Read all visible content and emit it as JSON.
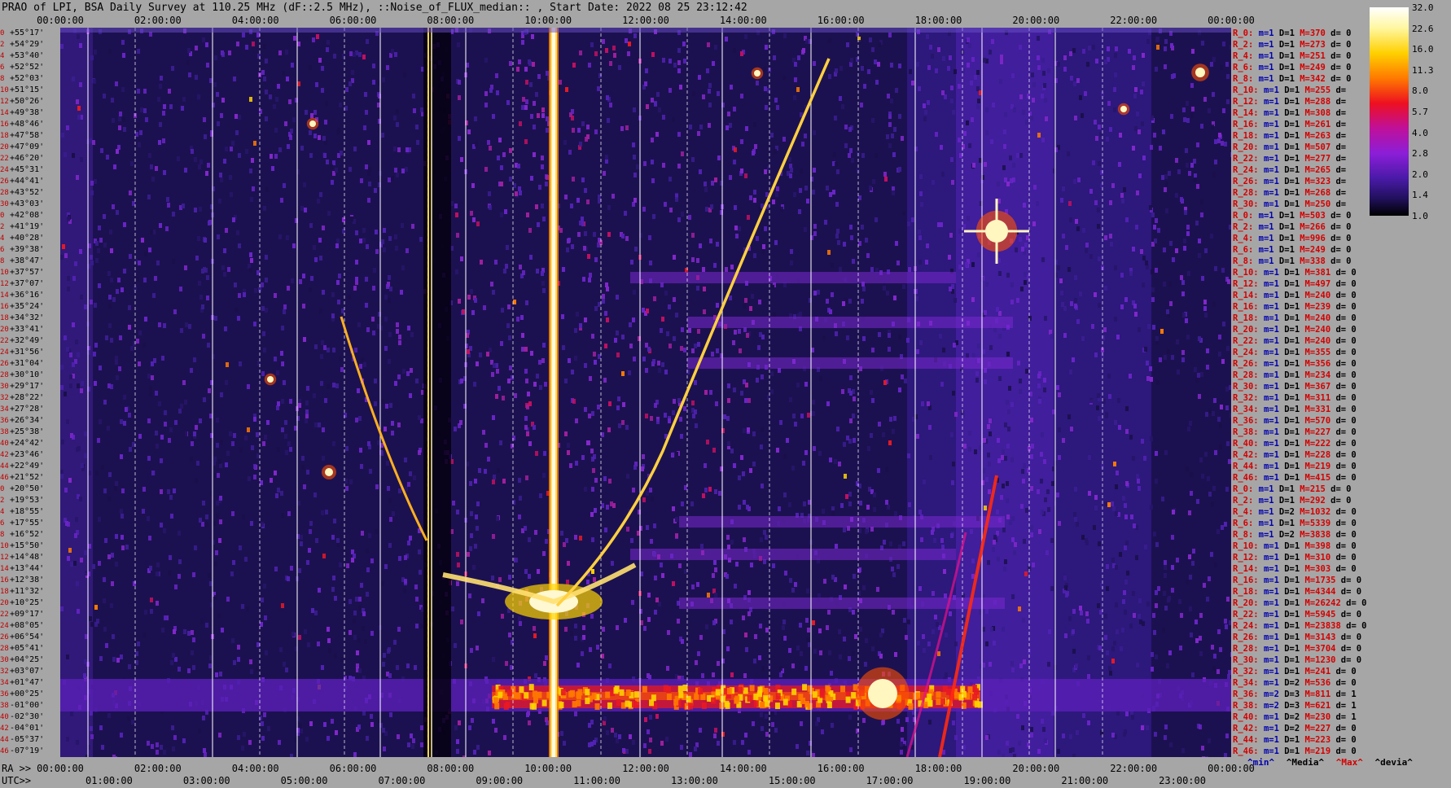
{
  "title": "PRAO of LPI, BSA Daily Survey at 110.25 MHz (dF::2.5 MHz), ::Noise_of_FLUX_median:: , Start Date: 2022 08 25 23:12:42",
  "top_ticks": [
    "00:00:00",
    "02:00:00",
    "04:00:00",
    "06:00:00",
    "08:00:00",
    "10:00:00",
    "12:00:00",
    "14:00:00",
    "16:00:00",
    "18:00:00",
    "20:00:00",
    "22:00:00",
    "00:00:00"
  ],
  "ra_label": "RA >>",
  "ra_ticks": [
    "00:00:00",
    "02:00:00",
    "04:00:00",
    "06:00:00",
    "08:00:00",
    "10:00:00",
    "12:00:00",
    "14:00:00",
    "16:00:00",
    "18:00:00",
    "20:00:00",
    "22:00:00",
    "00:00:00"
  ],
  "utc_label": "UTC>>",
  "utc_ticks": [
    "01:00:00",
    "03:00:00",
    "05:00:00",
    "07:00:00",
    "09:00:00",
    "11:00:00",
    "13:00:00",
    "15:00:00",
    "17:00:00",
    "19:00:00",
    "21:00:00",
    "23:00:00"
  ],
  "declinations": [
    "+55°17'",
    "+54°29'",
    "+53°40'",
    "+52°52'",
    "+52°03'",
    "+51°15'",
    "+50°26'",
    "+49°38'",
    "+48°46'",
    "+47°58'",
    "+47°09'",
    "+46°20'",
    "+45°31'",
    "+44°41'",
    "+43°52'",
    "+43°03'",
    "+42°08'",
    "+41°19'",
    "+40°28'",
    "+39°38'",
    "+38°47'",
    "+37°57'",
    "+37°07'",
    "+36°16'",
    "+35°24'",
    "+34°32'",
    "+33°41'",
    "+32°49'",
    "+31°56'",
    "+31°04'",
    "+30°10'",
    "+29°17'",
    "+28°22'",
    "+27°28'",
    "+26°34'",
    "+25°38'",
    "+24°42'",
    "+23°46'",
    "+22°49'",
    "+21°52'",
    "+20°50'",
    "+19°53'",
    "+18°55'",
    "+17°55'",
    "+16°52'",
    "+15°50'",
    "+14°48'",
    "+13°44'",
    "+12°38'",
    "+11°32'",
    "+10°25'",
    "+09°17'",
    "+08°05'",
    "+06°54'",
    "+05°41'",
    "+04°25'",
    "+03°07'",
    "+01°47'",
    "+00°25'",
    "-01°00'",
    "-02°30'",
    "-04°01'",
    "-05°37'",
    "-07°19'"
  ],
  "dec_index": [
    "0",
    "2",
    "4",
    "6",
    "8",
    "10",
    "12",
    "14",
    "16",
    "18",
    "20",
    "22",
    "24",
    "26",
    "28",
    "30",
    "0",
    "2",
    "4",
    "6",
    "8",
    "10",
    "12",
    "14",
    "16",
    "18",
    "20",
    "22",
    "24",
    "26",
    "28",
    "30",
    "32",
    "34",
    "36",
    "38",
    "40",
    "42",
    "44",
    "46",
    "0",
    "2",
    "4",
    "6",
    "8",
    "10",
    "12",
    "14",
    "16",
    "18",
    "20",
    "22",
    "24",
    "26",
    "28",
    "30",
    "32",
    "34",
    "36",
    "38",
    "40",
    "42",
    "44",
    "46"
  ],
  "stats": [
    {
      "r": "R_0:",
      "m": "m=1",
      "d": "D=1",
      "x": "M=370",
      "v": "d= 0"
    },
    {
      "r": "R_2:",
      "m": "m=1",
      "d": "D=1",
      "x": "M=273",
      "v": "d= 0"
    },
    {
      "r": "R_4:",
      "m": "m=1",
      "d": "D=1",
      "x": "M=251",
      "v": "d= 0"
    },
    {
      "r": "R_6:",
      "m": "m=1",
      "d": "D=1",
      "x": "M=249",
      "v": "d= 0"
    },
    {
      "r": "R_8:",
      "m": "m=1",
      "d": "D=1",
      "x": "M=342",
      "v": "d= 0"
    },
    {
      "r": "R_10:",
      "m": "m=1",
      "d": "D=1",
      "x": "M=255",
      "v": "d="
    },
    {
      "r": "R_12:",
      "m": "m=1",
      "d": "D=1",
      "x": "M=288",
      "v": "d="
    },
    {
      "r": "R_14:",
      "m": "m=1",
      "d": "D=1",
      "x": "M=308",
      "v": "d="
    },
    {
      "r": "R_16:",
      "m": "m=1",
      "d": "D=1",
      "x": "M=261",
      "v": "d="
    },
    {
      "r": "R_18:",
      "m": "m=1",
      "d": "D=1",
      "x": "M=263",
      "v": "d="
    },
    {
      "r": "R_20:",
      "m": "m=1",
      "d": "D=1",
      "x": "M=507",
      "v": "d="
    },
    {
      "r": "R_22:",
      "m": "m=1",
      "d": "D=1",
      "x": "M=277",
      "v": "d="
    },
    {
      "r": "R_24:",
      "m": "m=1",
      "d": "D=1",
      "x": "M=265",
      "v": "d="
    },
    {
      "r": "R_26:",
      "m": "m=1",
      "d": "D=1",
      "x": "M=323",
      "v": "d="
    },
    {
      "r": "R_28:",
      "m": "m=1",
      "d": "D=1",
      "x": "M=268",
      "v": "d="
    },
    {
      "r": "R_30:",
      "m": "m=1",
      "d": "D=1",
      "x": "M=250",
      "v": "d="
    },
    {
      "r": "R_0:",
      "m": "m=1",
      "d": "D=1",
      "x": "M=503",
      "v": "d= 0"
    },
    {
      "r": "R_2:",
      "m": "m=1",
      "d": "D=1",
      "x": "M=266",
      "v": "d= 0"
    },
    {
      "r": "R_4:",
      "m": "m=1",
      "d": "D=1",
      "x": "M=996",
      "v": "d= 0"
    },
    {
      "r": "R_6:",
      "m": "m=1",
      "d": "D=1",
      "x": "M=249",
      "v": "d= 0"
    },
    {
      "r": "R_8:",
      "m": "m=1",
      "d": "D=1",
      "x": "M=338",
      "v": "d= 0"
    },
    {
      "r": "R_10:",
      "m": "m=1",
      "d": "D=1",
      "x": "M=381",
      "v": "d= 0"
    },
    {
      "r": "R_12:",
      "m": "m=1",
      "d": "D=1",
      "x": "M=497",
      "v": "d= 0"
    },
    {
      "r": "R_14:",
      "m": "m=1",
      "d": "D=1",
      "x": "M=240",
      "v": "d= 0"
    },
    {
      "r": "R_16:",
      "m": "m=1",
      "d": "D=1",
      "x": "M=239",
      "v": "d= 0"
    },
    {
      "r": "R_18:",
      "m": "m=1",
      "d": "D=1",
      "x": "M=240",
      "v": "d= 0"
    },
    {
      "r": "R_20:",
      "m": "m=1",
      "d": "D=1",
      "x": "M=240",
      "v": "d= 0"
    },
    {
      "r": "R_22:",
      "m": "m=1",
      "d": "D=1",
      "x": "M=240",
      "v": "d= 0"
    },
    {
      "r": "R_24:",
      "m": "m=1",
      "d": "D=1",
      "x": "M=355",
      "v": "d= 0"
    },
    {
      "r": "R_26:",
      "m": "m=1",
      "d": "D=1",
      "x": "M=356",
      "v": "d= 0"
    },
    {
      "r": "R_28:",
      "m": "m=1",
      "d": "D=1",
      "x": "M=234",
      "v": "d= 0"
    },
    {
      "r": "R_30:",
      "m": "m=1",
      "d": "D=1",
      "x": "M=367",
      "v": "d= 0"
    },
    {
      "r": "R_32:",
      "m": "m=1",
      "d": "D=1",
      "x": "M=311",
      "v": "d= 0"
    },
    {
      "r": "R_34:",
      "m": "m=1",
      "d": "D=1",
      "x": "M=331",
      "v": "d= 0"
    },
    {
      "r": "R_36:",
      "m": "m=1",
      "d": "D=1",
      "x": "M=570",
      "v": "d= 0"
    },
    {
      "r": "R_38:",
      "m": "m=1",
      "d": "D=1",
      "x": "M=227",
      "v": "d= 0"
    },
    {
      "r": "R_40:",
      "m": "m=1",
      "d": "D=1",
      "x": "M=222",
      "v": "d= 0"
    },
    {
      "r": "R_42:",
      "m": "m=1",
      "d": "D=1",
      "x": "M=228",
      "v": "d= 0"
    },
    {
      "r": "R_44:",
      "m": "m=1",
      "d": "D=1",
      "x": "M=219",
      "v": "d= 0"
    },
    {
      "r": "R_46:",
      "m": "m=1",
      "d": "D=1",
      "x": "M=415",
      "v": "d= 0"
    },
    {
      "r": "R_0:",
      "m": "m=1",
      "d": "D=1",
      "x": "M=215",
      "v": "d= 0"
    },
    {
      "r": "R_2:",
      "m": "m=1",
      "d": "D=1",
      "x": "M=292",
      "v": "d= 0"
    },
    {
      "r": "R_4:",
      "m": "m=1",
      "d": "D=2",
      "x": "M=1032",
      "v": "d= 0"
    },
    {
      "r": "R_6:",
      "m": "m=1",
      "d": "D=1",
      "x": "M=5339",
      "v": "d= 0"
    },
    {
      "r": "R_8:",
      "m": "m=1",
      "d": "D=2",
      "x": "M=3838",
      "v": "d= 0"
    },
    {
      "r": "R_10:",
      "m": "m=1",
      "d": "D=1",
      "x": "M=398",
      "v": "d= 0"
    },
    {
      "r": "R_12:",
      "m": "m=1",
      "d": "D=1",
      "x": "M=310",
      "v": "d= 0"
    },
    {
      "r": "R_14:",
      "m": "m=1",
      "d": "D=1",
      "x": "M=303",
      "v": "d= 0"
    },
    {
      "r": "R_16:",
      "m": "m=1",
      "d": "D=1",
      "x": "M=1735",
      "v": "d= 0"
    },
    {
      "r": "R_18:",
      "m": "m=1",
      "d": "D=1",
      "x": "M=4344",
      "v": "d= 0"
    },
    {
      "r": "R_20:",
      "m": "m=1",
      "d": "D=1",
      "x": "M=26242",
      "v": "d= 0"
    },
    {
      "r": "R_22:",
      "m": "m=1",
      "d": "D=1",
      "x": "M=5945",
      "v": "d= 0"
    },
    {
      "r": "R_24:",
      "m": "m=1",
      "d": "D=1",
      "x": "M=23838",
      "v": "d= 0"
    },
    {
      "r": "R_26:",
      "m": "m=1",
      "d": "D=1",
      "x": "M=3143",
      "v": "d= 0"
    },
    {
      "r": "R_28:",
      "m": "m=1",
      "d": "D=1",
      "x": "M=3704",
      "v": "d= 0"
    },
    {
      "r": "R_30:",
      "m": "m=1",
      "d": "D=1",
      "x": "M=1230",
      "v": "d= 0"
    },
    {
      "r": "R_32:",
      "m": "m=1",
      "d": "D=1",
      "x": "M=241",
      "v": "d= 0"
    },
    {
      "r": "R_34:",
      "m": "m=1",
      "d": "D=2",
      "x": "M=536",
      "v": "d= 0"
    },
    {
      "r": "R_36:",
      "m": "m=2",
      "d": "D=3",
      "x": "M=811",
      "v": "d= 1"
    },
    {
      "r": "R_38:",
      "m": "m=2",
      "d": "D=3",
      "x": "M=621",
      "v": "d= 1"
    },
    {
      "r": "R_40:",
      "m": "m=1",
      "d": "D=2",
      "x": "M=230",
      "v": "d= 1"
    },
    {
      "r": "R_42:",
      "m": "m=1",
      "d": "D=2",
      "x": "M=227",
      "v": "d= 0"
    },
    {
      "r": "R_44:",
      "m": "m=1",
      "d": "D=1",
      "x": "M=223",
      "v": "d= 0"
    },
    {
      "r": "R_46:",
      "m": "m=1",
      "d": "D=1",
      "x": "M=219",
      "v": "d= 0"
    }
  ],
  "stat_legend": {
    "min": "^min^",
    "median": "^Media^",
    "max": "^Max^",
    "dev": "^devia^"
  },
  "colorbar_ticks": [
    "32.0",
    "22.6",
    "16.0",
    "11.3",
    "8.0",
    "5.7",
    "4.0",
    "2.8",
    "2.0",
    "1.4",
    "1.0"
  ],
  "colors": {
    "background": "#a6a6a6",
    "plot_bg": "#140c3a",
    "accent_red": "#d40000",
    "accent_blue": "#0000b0"
  }
}
